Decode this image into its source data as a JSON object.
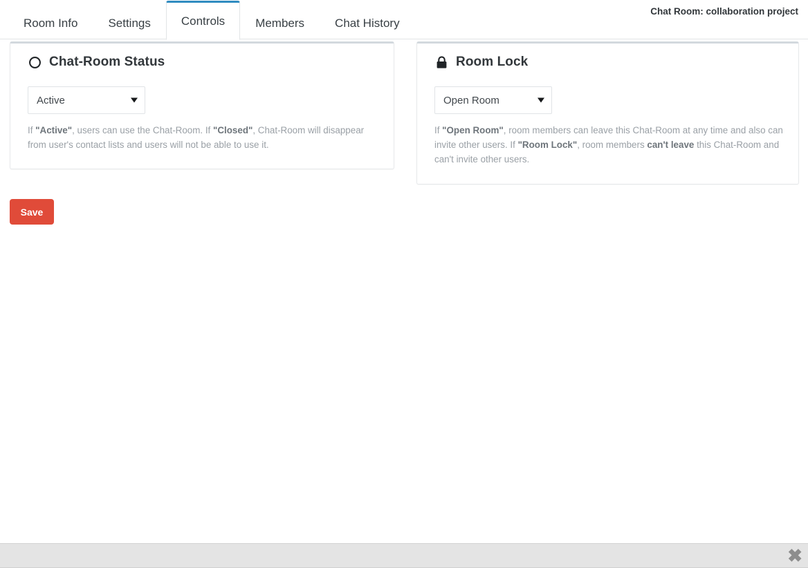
{
  "header": {
    "tabs": [
      {
        "label": "Room Info",
        "active": false
      },
      {
        "label": "Settings",
        "active": false
      },
      {
        "label": "Controls",
        "active": true
      },
      {
        "label": "Members",
        "active": false
      },
      {
        "label": "Chat History",
        "active": false
      }
    ],
    "room_title": "Chat Room: collaboration project",
    "active_tab_accent": "#2e8bc0"
  },
  "cards": {
    "status": {
      "icon": "circle-o-icon",
      "title": "Chat-Room Status",
      "select": {
        "value": "Active",
        "options": [
          "Active",
          "Closed"
        ]
      },
      "help": {
        "part1": "If ",
        "bold1": "\"Active\"",
        "part2": ", users can use the Chat-Room. If ",
        "bold2": "\"Closed\"",
        "part3": ", Chat-Room will disappear from user's contact lists and users will not be able to use it."
      }
    },
    "lock": {
      "icon": "lock-icon",
      "title": "Room Lock",
      "select": {
        "value": "Open Room",
        "options": [
          "Open Room",
          "Room Lock"
        ]
      },
      "help": {
        "part1": "If ",
        "bold1": "\"Open Room\"",
        "part2": ", room members can leave this Chat-Room at any time and also can invite other users. If ",
        "bold2": "\"Room Lock\"",
        "part3": ", room members ",
        "bold3": "can't leave",
        "part4": " this Chat-Room and can't invite other users."
      }
    }
  },
  "actions": {
    "save_label": "Save",
    "save_color": "#e04b39"
  },
  "footer": {
    "close_icon": "close-icon",
    "close_glyph": "✖"
  }
}
